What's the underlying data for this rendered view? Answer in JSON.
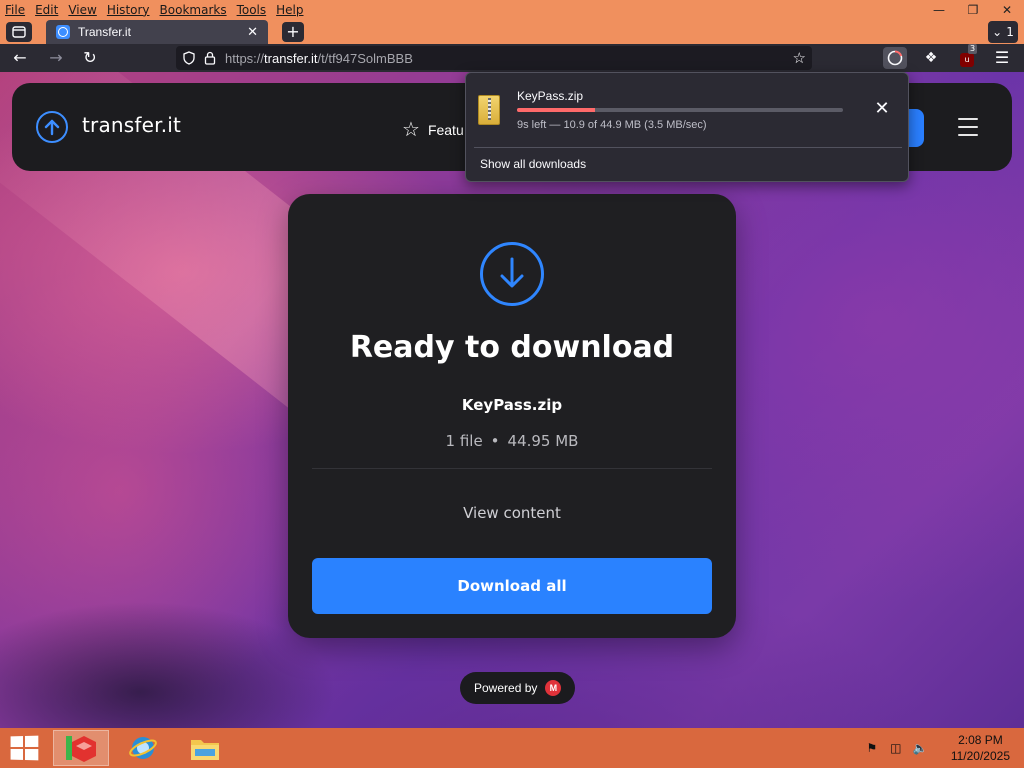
{
  "browser": {
    "menu": [
      "File",
      "Edit",
      "View",
      "History",
      "Bookmarks",
      "Tools",
      "Help"
    ],
    "tab": {
      "title": "Transfer.it"
    },
    "tab_count": "1",
    "url": {
      "prefix": "https://",
      "host": "transfer.it",
      "path": "/t/tf947SolmBBB"
    },
    "extension_badge": "3"
  },
  "site": {
    "logo_text": "transfer.it",
    "nav_features": "Featu"
  },
  "card": {
    "title": "Ready to download",
    "file_name": "KeyPass.zip",
    "file_count": "1 file",
    "file_size": "44.95 MB",
    "view_content": "View content",
    "download_all": "Download all"
  },
  "footer": {
    "powered_by": "Powered by",
    "mega_letter": "M"
  },
  "downloads_panel": {
    "file_name": "KeyPass.zip",
    "status": "9s left — 10.9 of 44.9 MB (3.5 MB/sec)",
    "progress_fraction": 0.24,
    "show_all": "Show all downloads"
  },
  "taskbar": {
    "time": "2:08 PM",
    "date": "11/20/2025"
  },
  "colors": {
    "accent": "#2a82ff",
    "progress": "#ff6a6a",
    "titlebar": "#f0905e",
    "taskbar": "#d9683e"
  }
}
